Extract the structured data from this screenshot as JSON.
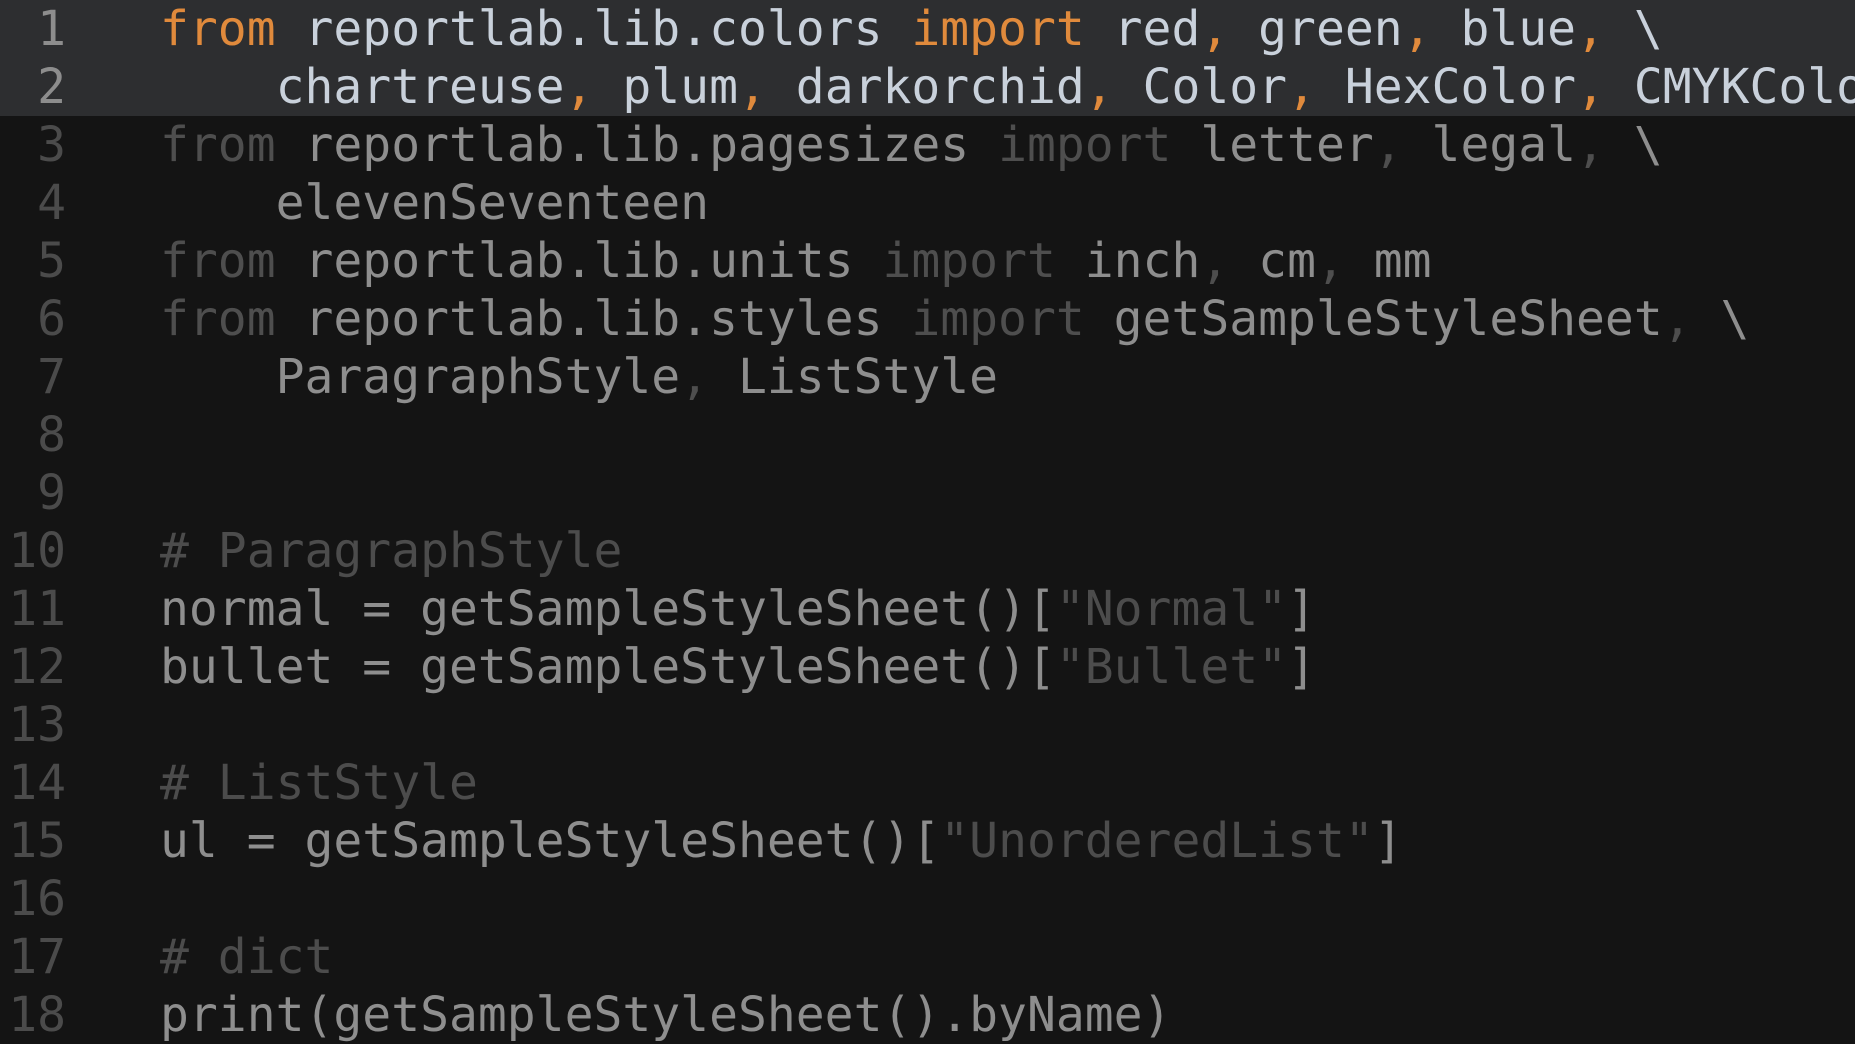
{
  "editor": {
    "colors": {
      "background": "#141414",
      "highlight_line": "#2d2e30",
      "keyword_active": "#e08a3c",
      "punct_active": "#e08a3c",
      "text_active": "#c9d1db",
      "keyword_dim": "#4e4e4e",
      "text_dim": "#8e8e8e",
      "comment": "#4c4c4c",
      "string": "#4c4c4c"
    },
    "lines": [
      {
        "num": "1",
        "highlight": true,
        "tokens": [
          {
            "t": "from",
            "k": "kwa"
          },
          {
            "t": " reportlab.lib.colors ",
            "k": "txa"
          },
          {
            "t": "import",
            "k": "kwa"
          },
          {
            "t": " red",
            "k": "txa"
          },
          {
            "t": ",",
            "k": "pca"
          },
          {
            "t": " green",
            "k": "txa"
          },
          {
            "t": ",",
            "k": "pca"
          },
          {
            "t": " blue",
            "k": "txa"
          },
          {
            "t": ",",
            "k": "pca"
          },
          {
            "t": " \\",
            "k": "txa"
          }
        ]
      },
      {
        "num": "2",
        "highlight": true,
        "tokens": [
          {
            "t": "    chartreuse",
            "k": "txa"
          },
          {
            "t": ",",
            "k": "pca"
          },
          {
            "t": " plum",
            "k": "txa"
          },
          {
            "t": ",",
            "k": "pca"
          },
          {
            "t": " darkorchid",
            "k": "txa"
          },
          {
            "t": ",",
            "k": "pca"
          },
          {
            "t": " Color",
            "k": "txa"
          },
          {
            "t": ",",
            "k": "pca"
          },
          {
            "t": " HexColor",
            "k": "txa"
          },
          {
            "t": ",",
            "k": "pca"
          },
          {
            "t": " CMYKColor",
            "k": "txa"
          }
        ]
      },
      {
        "num": "3",
        "highlight": false,
        "tokens": [
          {
            "t": "from",
            "k": "kwd"
          },
          {
            "t": " reportlab.lib.pagesizes ",
            "k": "txd"
          },
          {
            "t": "import",
            "k": "kwd"
          },
          {
            "t": " letter",
            "k": "txd"
          },
          {
            "t": ",",
            "k": "kwd"
          },
          {
            "t": " legal",
            "k": "txd"
          },
          {
            "t": ",",
            "k": "kwd"
          },
          {
            "t": " \\",
            "k": "txd"
          }
        ]
      },
      {
        "num": "4",
        "highlight": false,
        "tokens": [
          {
            "t": "    elevenSeventeen",
            "k": "txd"
          }
        ]
      },
      {
        "num": "5",
        "highlight": false,
        "tokens": [
          {
            "t": "from",
            "k": "kwd"
          },
          {
            "t": " reportlab.lib.units ",
            "k": "txd"
          },
          {
            "t": "import",
            "k": "kwd"
          },
          {
            "t": " inch",
            "k": "txd"
          },
          {
            "t": ",",
            "k": "kwd"
          },
          {
            "t": " cm",
            "k": "txd"
          },
          {
            "t": ",",
            "k": "kwd"
          },
          {
            "t": " mm",
            "k": "txd"
          }
        ]
      },
      {
        "num": "6",
        "highlight": false,
        "tokens": [
          {
            "t": "from",
            "k": "kwd"
          },
          {
            "t": " reportlab.lib.styles ",
            "k": "txd"
          },
          {
            "t": "import",
            "k": "kwd"
          },
          {
            "t": " getSampleStyleSheet",
            "k": "txd"
          },
          {
            "t": ",",
            "k": "kwd"
          },
          {
            "t": " \\",
            "k": "txd"
          }
        ]
      },
      {
        "num": "7",
        "highlight": false,
        "tokens": [
          {
            "t": "    ParagraphStyle",
            "k": "txd"
          },
          {
            "t": ",",
            "k": "kwd"
          },
          {
            "t": " ListStyle",
            "k": "txd"
          }
        ]
      },
      {
        "num": "8",
        "highlight": false,
        "tokens": []
      },
      {
        "num": "9",
        "highlight": false,
        "tokens": []
      },
      {
        "num": "10",
        "highlight": false,
        "tokens": [
          {
            "t": "# ParagraphStyle",
            "k": "cmt"
          }
        ]
      },
      {
        "num": "11",
        "highlight": false,
        "tokens": [
          {
            "t": "normal = getSampleStyleSheet()[",
            "k": "txd"
          },
          {
            "t": "\"Normal\"",
            "k": "str"
          },
          {
            "t": "]",
            "k": "txd"
          }
        ]
      },
      {
        "num": "12",
        "highlight": false,
        "tokens": [
          {
            "t": "bullet = getSampleStyleSheet()[",
            "k": "txd"
          },
          {
            "t": "\"Bullet\"",
            "k": "str"
          },
          {
            "t": "]",
            "k": "txd"
          }
        ]
      },
      {
        "num": "13",
        "highlight": false,
        "tokens": []
      },
      {
        "num": "14",
        "highlight": false,
        "tokens": [
          {
            "t": "# ListStyle",
            "k": "cmt"
          }
        ]
      },
      {
        "num": "15",
        "highlight": false,
        "tokens": [
          {
            "t": "ul = getSampleStyleSheet()[",
            "k": "txd"
          },
          {
            "t": "\"UnorderedList\"",
            "k": "str"
          },
          {
            "t": "]",
            "k": "txd"
          }
        ]
      },
      {
        "num": "16",
        "highlight": false,
        "tokens": []
      },
      {
        "num": "17",
        "highlight": false,
        "tokens": [
          {
            "t": "# dict",
            "k": "cmt"
          }
        ]
      },
      {
        "num": "18",
        "highlight": false,
        "tokens": [
          {
            "t": "print(getSampleStyleSheet().byName)",
            "k": "txd"
          }
        ]
      }
    ]
  }
}
